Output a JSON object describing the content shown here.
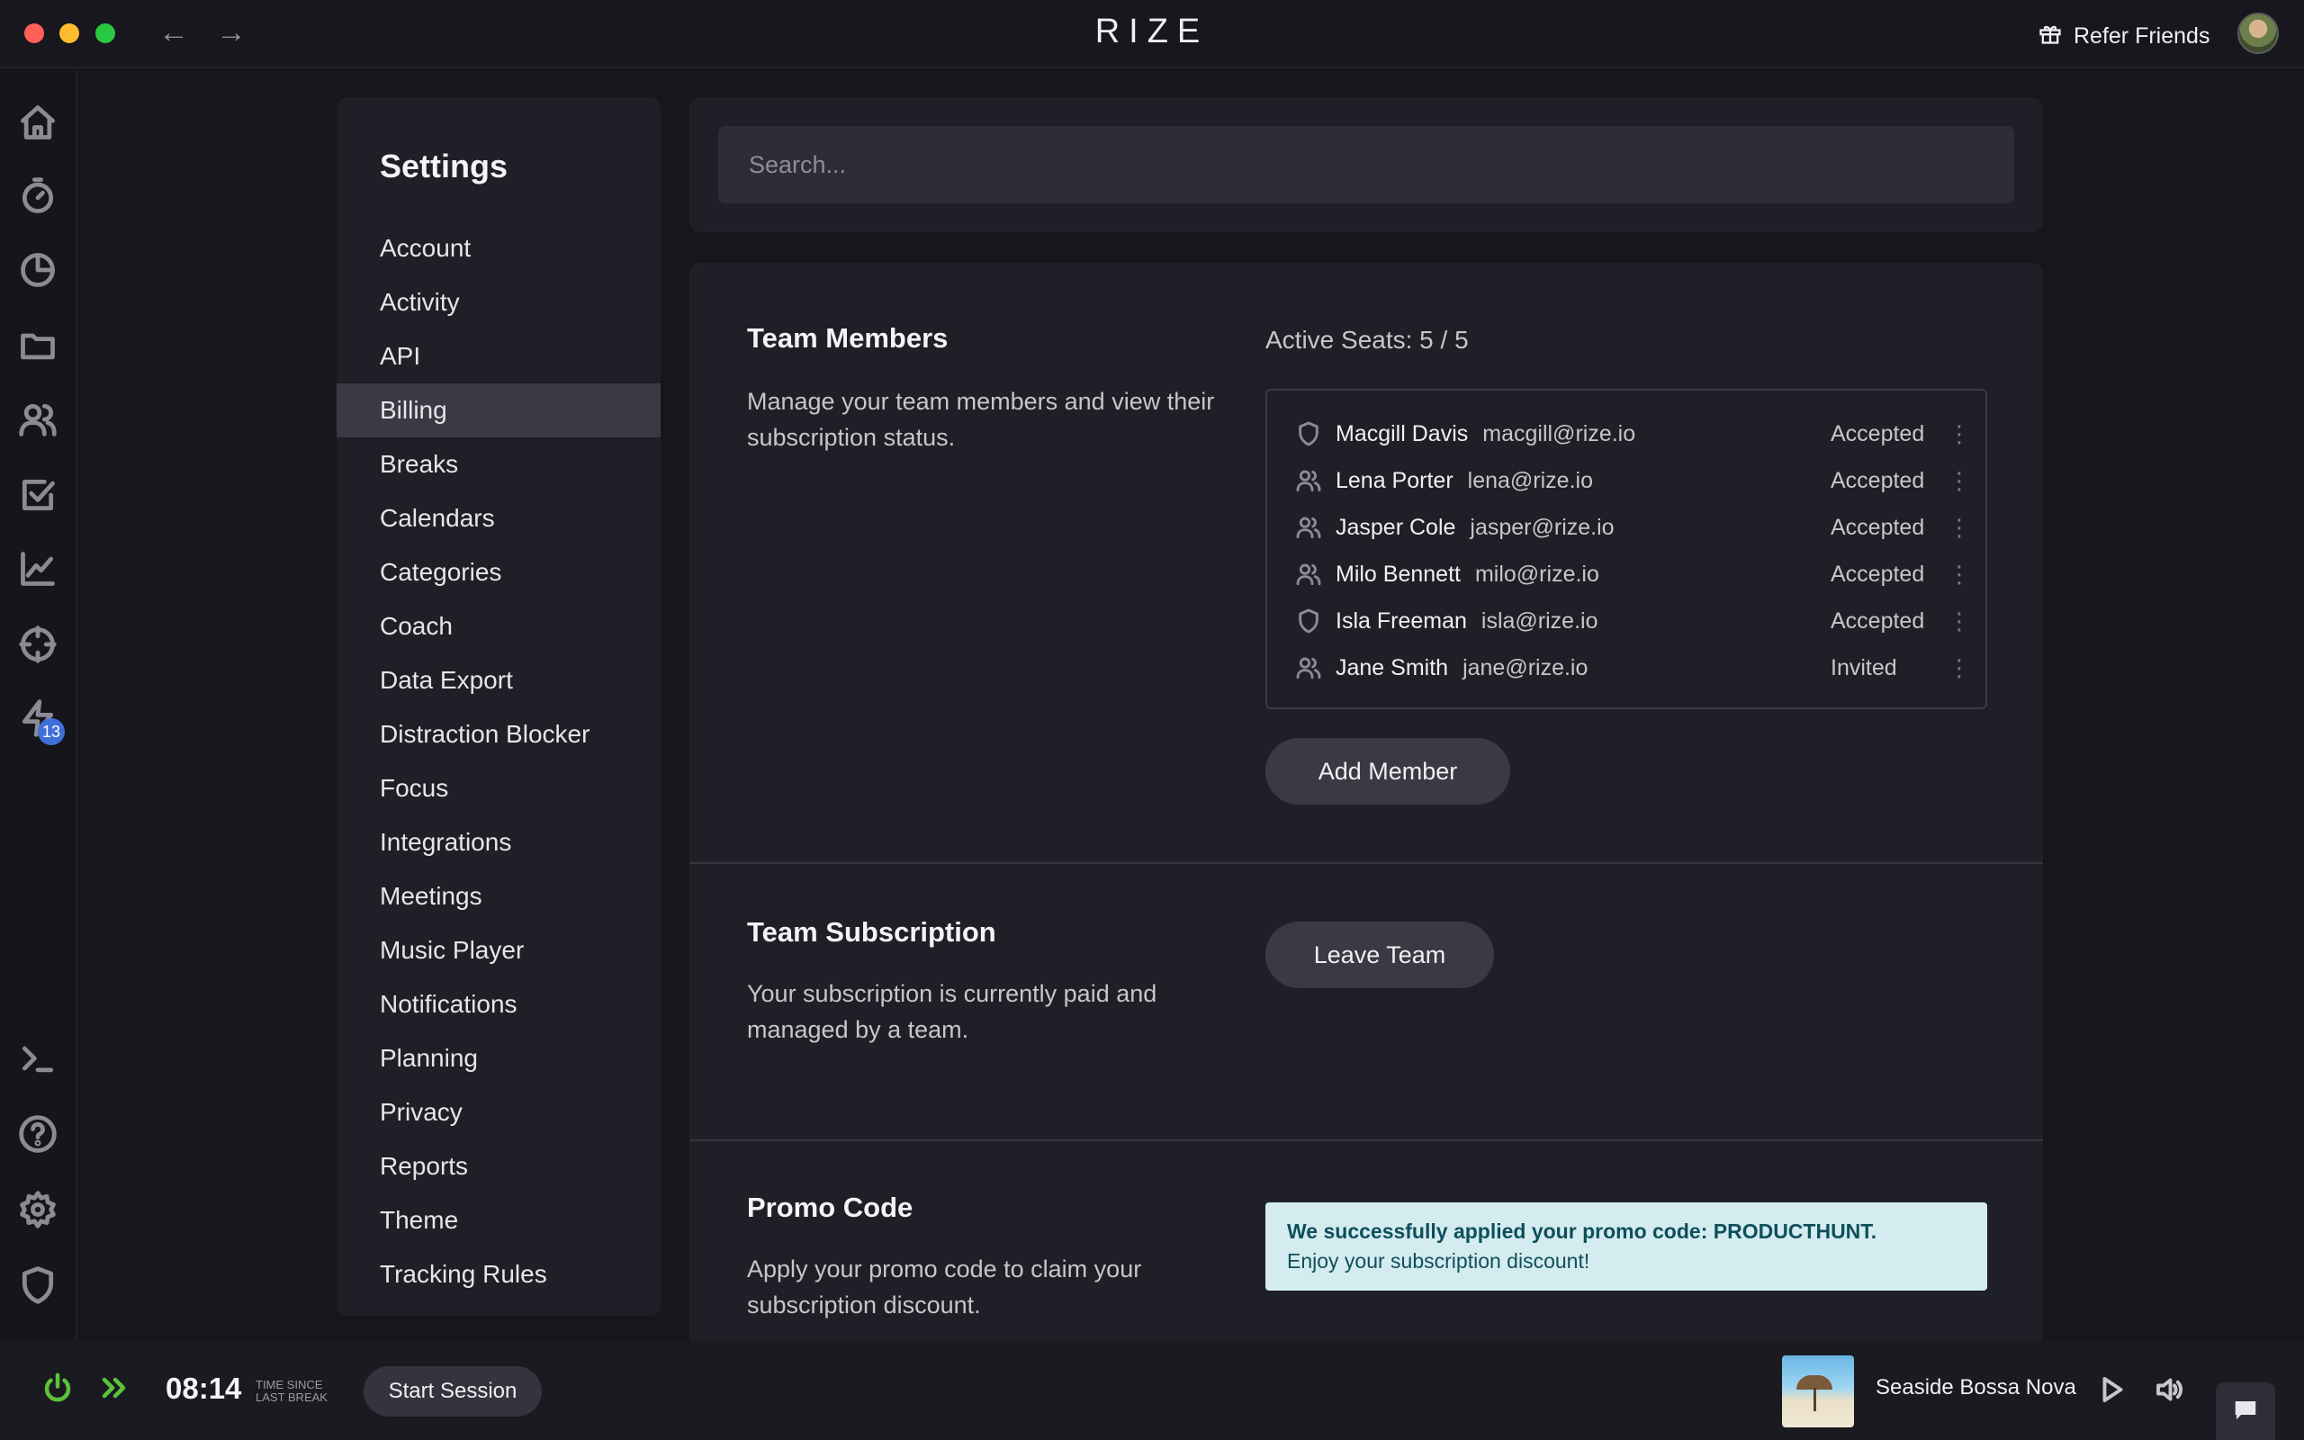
{
  "app": {
    "brand": "RIZE",
    "nav_back": "←",
    "nav_forward": "→",
    "refer_label": "Refer Friends"
  },
  "rail": {
    "items": [
      {
        "icon": "home-icon"
      },
      {
        "icon": "timer-icon"
      },
      {
        "icon": "pie-chart-icon"
      },
      {
        "icon": "folder-icon"
      },
      {
        "icon": "users-icon"
      },
      {
        "icon": "checkbox-icon"
      },
      {
        "icon": "trend-chart-icon"
      },
      {
        "icon": "crosshair-icon"
      },
      {
        "icon": "lightning-icon",
        "badge": "13"
      }
    ],
    "bottom_items": [
      {
        "icon": "terminal-icon"
      },
      {
        "icon": "help-icon"
      },
      {
        "icon": "gear-icon"
      },
      {
        "icon": "shield-icon"
      }
    ]
  },
  "settings": {
    "title": "Settings",
    "items": [
      "Account",
      "Activity",
      "API",
      "Billing",
      "Breaks",
      "Calendars",
      "Categories",
      "Coach",
      "Data Export",
      "Distraction Blocker",
      "Focus",
      "Integrations",
      "Meetings",
      "Music Player",
      "Notifications",
      "Planning",
      "Privacy",
      "Reports",
      "Theme",
      "Tracking Rules"
    ],
    "active": "Billing"
  },
  "search": {
    "placeholder": "Search..."
  },
  "team_members": {
    "title": "Team Members",
    "description": "Manage your team members and view their subscription status.",
    "seats": "Active Seats: 5 / 5",
    "members": [
      {
        "name": "Macgill Davis",
        "email": "macgill@rize.io",
        "status": "Accepted",
        "role_icon": "shield-icon"
      },
      {
        "name": "Lena Porter",
        "email": "lena@rize.io",
        "status": "Accepted",
        "role_icon": "users-icon"
      },
      {
        "name": "Jasper Cole",
        "email": "jasper@rize.io",
        "status": "Accepted",
        "role_icon": "users-icon"
      },
      {
        "name": "Milo Bennett",
        "email": "milo@rize.io",
        "status": "Accepted",
        "role_icon": "users-icon"
      },
      {
        "name": "Isla Freeman",
        "email": "isla@rize.io",
        "status": "Accepted",
        "role_icon": "shield-icon"
      },
      {
        "name": "Jane Smith",
        "email": "jane@rize.io",
        "status": "Invited",
        "role_icon": "users-icon"
      }
    ],
    "menu_glyph": "⋮",
    "add_button": "Add Member"
  },
  "team_subscription": {
    "title": "Team Subscription",
    "description": "Your subscription is currently paid and managed by a team.",
    "leave_button": "Leave Team"
  },
  "promo": {
    "title": "Promo Code",
    "description": "Apply your promo code to claim your subscription discount.",
    "alert_title": "We successfully applied your promo code: PRODUCTHUNT.",
    "alert_body": "Enjoy your subscription discount!"
  },
  "bottombar": {
    "timer": "08:14",
    "timer_label": "TIME SINCE LAST BREAK",
    "start_session": "Start Session",
    "track": "Seaside Bossa Nova"
  },
  "colors": {
    "accent_green": "#5cc23a",
    "badge_blue": "#3f6fd8",
    "alert_bg": "#d4ecef",
    "alert_text": "#0e4f5c"
  }
}
